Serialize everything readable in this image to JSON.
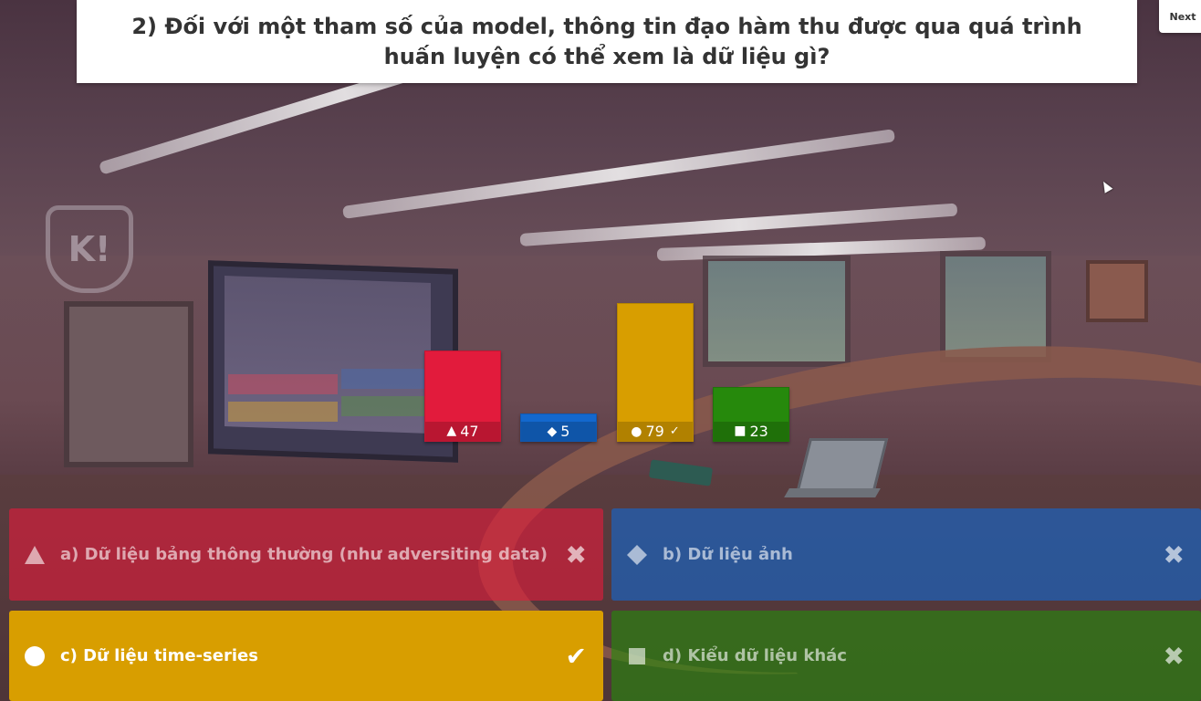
{
  "question": {
    "text": "2) Đối với một tham số của model, thông tin đạo hàm thu được qua quá trình huấn luyện có thể xem là dữ liệu gì?"
  },
  "navigation": {
    "next_label": "Next"
  },
  "results": [
    {
      "shape_icon": "triangle-icon",
      "glyph": "▲",
      "count": "47",
      "color": "#e21b3c",
      "correct": false,
      "check": ""
    },
    {
      "shape_icon": "diamond-icon",
      "glyph": "◆",
      "count": "5",
      "color": "#1368ce",
      "correct": false,
      "check": ""
    },
    {
      "shape_icon": "circle-icon",
      "glyph": "●",
      "count": "79",
      "color": "#d89e00",
      "correct": true,
      "check": "✓"
    },
    {
      "shape_icon": "square-icon",
      "glyph": "■",
      "count": "23",
      "color": "#26890c",
      "correct": false,
      "check": ""
    }
  ],
  "answers": [
    {
      "label": "a) Dữ liệu bảng thông thường (như adversiting data)",
      "shape_icon": "triangle-icon",
      "color": "#e21b3c",
      "correct": false,
      "mark": "✖",
      "mark_icon": "cross-icon"
    },
    {
      "label": "b) Dữ liệu ảnh",
      "shape_icon": "diamond-icon",
      "color": "#1368ce",
      "correct": false,
      "mark": "✖",
      "mark_icon": "cross-icon"
    },
    {
      "label": "c) Dữ liệu time-series",
      "shape_icon": "circle-icon",
      "color": "#d89e00",
      "correct": true,
      "mark": "✔",
      "mark_icon": "checkmark-icon"
    },
    {
      "label": "d) Kiểu dữ liệu khác",
      "shape_icon": "square-icon",
      "color": "#26890c",
      "correct": false,
      "mark": "✖",
      "mark_icon": "cross-icon"
    }
  ]
}
